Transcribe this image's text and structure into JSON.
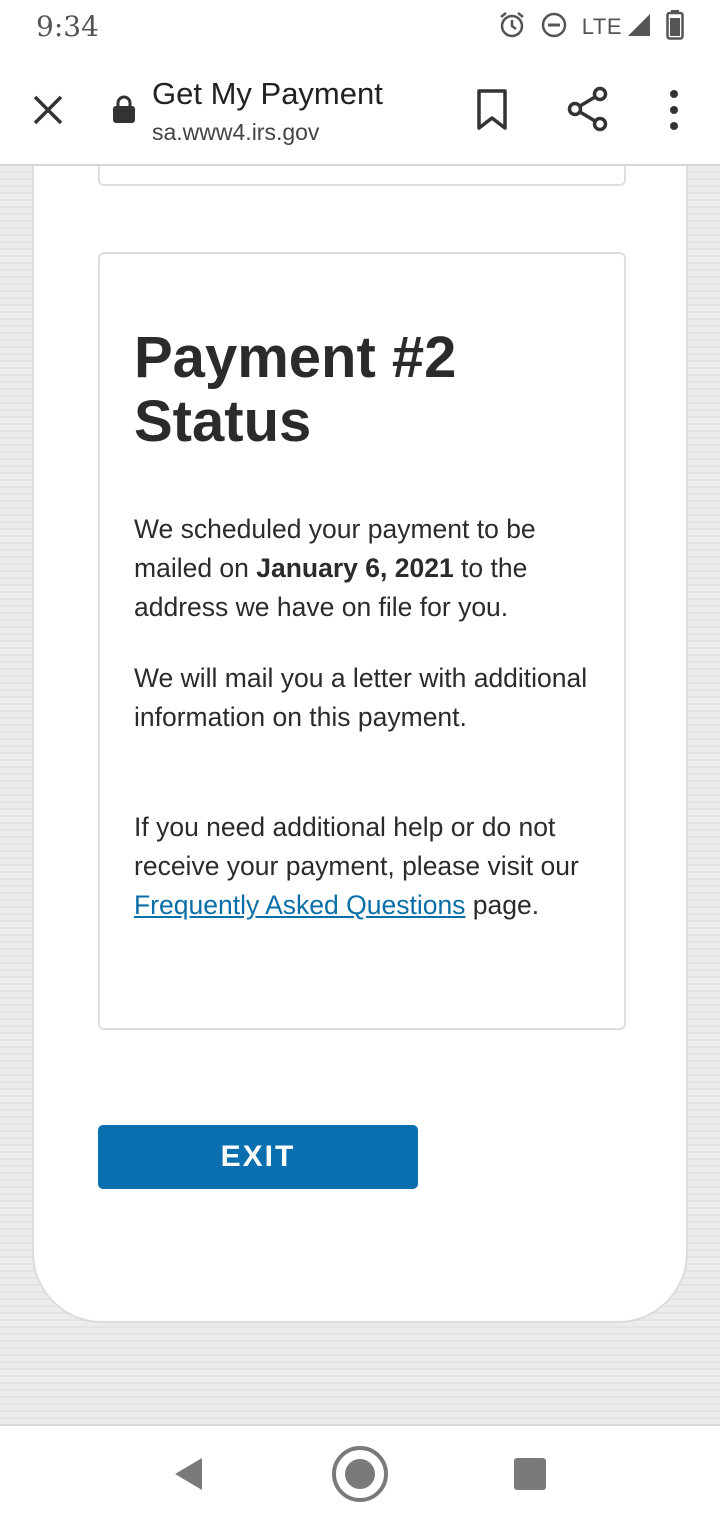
{
  "status_bar": {
    "time": "9:34",
    "network": "LTE",
    "icons": [
      "alarm-icon",
      "do-not-disturb-icon",
      "signal-icon",
      "battery-icon"
    ]
  },
  "browser": {
    "page_title": "Get My Payment",
    "url": "sa.www4.irs.gov",
    "icons": [
      "close-icon",
      "lock-icon",
      "bookmark-icon",
      "share-icon",
      "more-vert-icon"
    ]
  },
  "card": {
    "title": "Payment #2 Status",
    "para1": {
      "before": "We scheduled your payment to be mailed on ",
      "date": "January 6, 2021",
      "after": " to the address we have on file for you."
    },
    "para2": "We will mail you a letter with additional information on this payment.",
    "para3": {
      "before": "If you need additional help or do not receive your payment, please visit our ",
      "link_text": "Frequently Asked Questions",
      "after": " page."
    }
  },
  "exit_button": {
    "label": "EXIT"
  },
  "colors": {
    "accent": "#0a6fae",
    "link": "#0a6ea8",
    "text": "#2b2b2b"
  },
  "nav": {
    "icons": [
      "back-icon",
      "home-icon",
      "recents-icon"
    ]
  }
}
